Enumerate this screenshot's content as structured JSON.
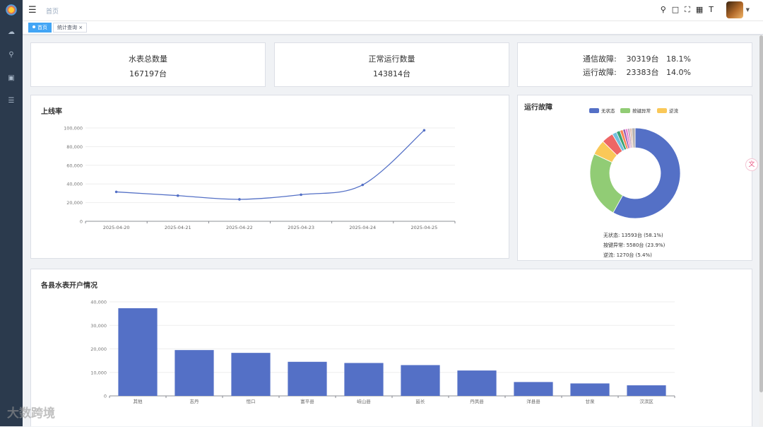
{
  "topbar": {
    "breadcrumb": "首页",
    "icons": [
      "search-icon",
      "chat-icon",
      "fullscreen-icon",
      "translate-icon",
      "font-size-icon"
    ]
  },
  "tags": [
    {
      "label": "首页",
      "active": true
    },
    {
      "label": "统计查询 ×",
      "active": false
    }
  ],
  "stats": {
    "total": {
      "title": "水表总数量",
      "value": "167197台"
    },
    "normal": {
      "title": "正常运行数量",
      "value": "143814台"
    },
    "faults": [
      {
        "label": "通信故障:",
        "count": "30319台",
        "pct": "18.1%"
      },
      {
        "label": "运行故障:",
        "count": "23383台",
        "pct": "14.0%"
      }
    ]
  },
  "online": {
    "title": "上线率"
  },
  "fault_pie": {
    "title": "运行故障",
    "legend": [
      "无状态",
      "按键异常",
      "逆流"
    ],
    "summary": [
      "无状态: 13593台 (58.1%)",
      "按键异常: 5580台 (23.9%)",
      "逆流: 1270台 (5.4%)"
    ]
  },
  "county": {
    "title": "各县水表开户情况"
  },
  "colors": {
    "primary": "#5470c6",
    "green": "#91cc75",
    "yellow": "#fac858",
    "red": "#ee6666",
    "cyan": "#73c0de",
    "sidebar": "#2b3a4d",
    "tag_active": "#42a5f5"
  },
  "watermark": "大数跨境",
  "chart_data": [
    {
      "type": "line",
      "title": "上线率",
      "x": [
        "2025-04-20",
        "2025-04-21",
        "2025-04-22",
        "2025-04-23",
        "2025-04-24",
        "2025-04-25"
      ],
      "values": [
        31500,
        27500,
        23500,
        28500,
        39000,
        97500
      ],
      "ylim": [
        0,
        100000
      ],
      "yticks": [
        "0",
        "20,000",
        "40,000",
        "60,000",
        "80,000",
        "100,000"
      ],
      "smooth": true,
      "grid": true
    },
    {
      "type": "pie",
      "title": "运行故障",
      "donut": true,
      "legend_position": "top",
      "slices": [
        {
          "name": "无状态",
          "value": 58.1
        },
        {
          "name": "按键异常",
          "value": 23.9
        },
        {
          "name": "逆流",
          "value": 5.4
        },
        {
          "name": "",
          "value": 4.2
        },
        {
          "name": "",
          "value": 1.6
        },
        {
          "name": "",
          "value": 1.3
        },
        {
          "name": "",
          "value": 1.1
        },
        {
          "name": "",
          "value": 0.9
        },
        {
          "name": "",
          "value": 0.8
        },
        {
          "name": "",
          "value": 0.8
        },
        {
          "name": "",
          "value": 0.7
        },
        {
          "name": "",
          "value": 1.2
        }
      ]
    },
    {
      "type": "bar",
      "title": "各县水表开户情况",
      "categories": [
        "其他",
        "志丹",
        "恒口",
        "富平县",
        "岐山县",
        "延长",
        "丹凤县",
        "洋县县",
        "甘泉",
        "汉滨区"
      ],
      "values": [
        37300,
        19500,
        18300,
        14500,
        14000,
        13100,
        10800,
        5900,
        5300,
        4500
      ],
      "ylim": [
        0,
        40000
      ],
      "yticks": [
        "0",
        "10,000",
        "20,000",
        "30,000",
        "40,000"
      ],
      "grid": true
    }
  ]
}
